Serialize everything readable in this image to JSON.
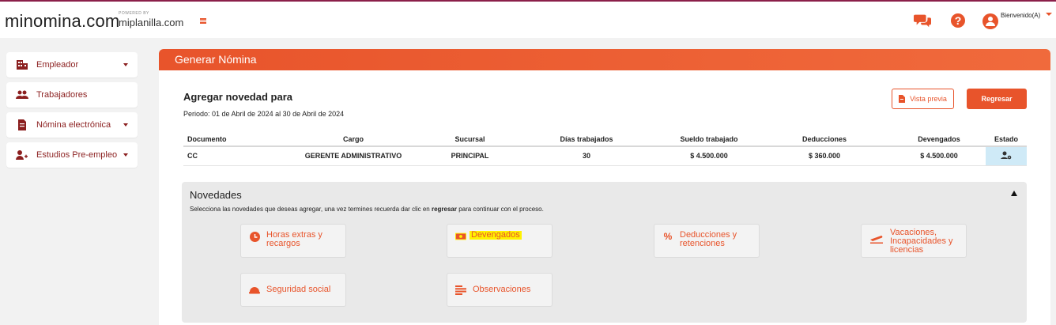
{
  "header": {
    "logo": "minomina.com",
    "powered_by": "POWERED BY",
    "brand": "miplanilla.com",
    "welcome": "Bienvenido(A)"
  },
  "sidebar": {
    "items": [
      {
        "label": "Empleador",
        "icon": "building-icon",
        "has_caret": true
      },
      {
        "label": "Trabajadores",
        "icon": "users-icon",
        "has_caret": false
      },
      {
        "label": "Nómina electrónica",
        "icon": "document-icon",
        "has_caret": true
      },
      {
        "label": "Estudios Pre-empleo",
        "icon": "user-plus-icon",
        "has_caret": true
      }
    ]
  },
  "main": {
    "title": "Generar Nómina",
    "agregar_label": "Agregar novedad para",
    "periodo": "Periodo: 01 de Abril de 2024 al 30 de Abril de 2024",
    "preview_button": "Vista previa",
    "back_button": "Regresar"
  },
  "table": {
    "headers": [
      "Documento",
      "Cargo",
      "Sucursal",
      "Días trabajados",
      "Sueldo trabajado",
      "Deducciones",
      "Devengados",
      "Estado"
    ],
    "row": {
      "documento": "CC",
      "cargo": "GERENTE ADMINISTRATIVO",
      "sucursal": "PRINCIPAL",
      "dias": "30",
      "sueldo": "$ 4.500.000",
      "deducciones": "$ 360.000",
      "devengados": "$ 4.500.000"
    }
  },
  "novedades": {
    "title": "Novedades",
    "desc_before": "Selecciona las novedades que deseas agregar, una vez termines recuerda dar clic en ",
    "desc_bold": "regresar",
    "desc_after": " para continuar con el proceso.",
    "buttons": {
      "horas": "Horas extras y recargos",
      "devengados": "Devengados",
      "deducciones": "Deducciones y retenciones",
      "vacaciones": "Vacaciones, Incapacidades y licencias",
      "seguridad": "Seguridad social",
      "observaciones": "Observaciones"
    }
  },
  "colors": {
    "accent": "#e8542b",
    "sidebar_text": "#8b1f1f",
    "highlight": "#fff200",
    "estado_bg": "#cfeaf7"
  }
}
